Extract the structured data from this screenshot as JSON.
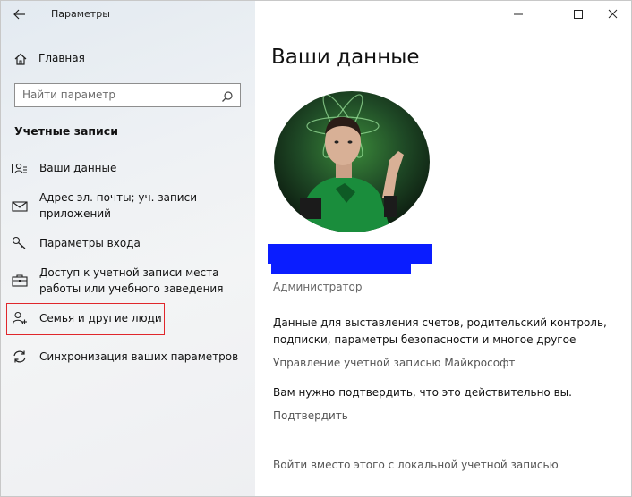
{
  "window": {
    "title": "Параметры"
  },
  "sidebar": {
    "home_label": "Главная",
    "search_placeholder": "Найти параметр",
    "section_title": "Учетные записи",
    "items": [
      {
        "label": "Ваши данные",
        "icon": "user-info-icon"
      },
      {
        "label": "Адрес эл. почты; уч. записи приложений",
        "icon": "mail-icon"
      },
      {
        "label": "Параметры входа",
        "icon": "key-icon"
      },
      {
        "label": "Доступ к учетной записи места работы или учебного заведения",
        "icon": "briefcase-icon"
      },
      {
        "label": "Семья и другие люди",
        "icon": "person-add-icon"
      },
      {
        "label": "Синхронизация ваших параметров",
        "icon": "sync-icon"
      }
    ],
    "highlighted_item": "Семья и другие люди"
  },
  "main": {
    "title": "Ваши данные",
    "role": "Администратор",
    "description": "Данные для выставления счетов, родительский контроль, подписки, параметры безопасности и многое другое",
    "manage_link": "Управление учетной записью Майкрософт",
    "verify_text": "Вам нужно подтвердить, что это действительно вы.",
    "verify_link": "Подтвердить",
    "local_account_link": "Войти вместо этого с локальной учетной записью"
  },
  "colors": {
    "highlight_border": "#e0262b",
    "redaction": "#0a1dff"
  }
}
